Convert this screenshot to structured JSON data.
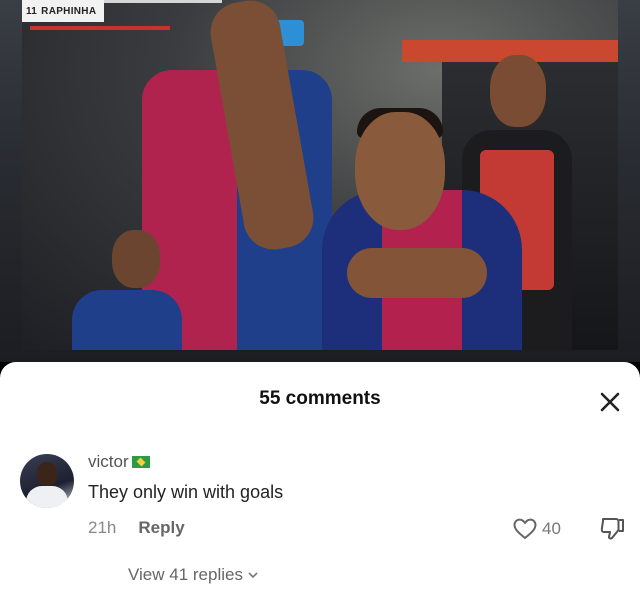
{
  "video": {
    "scorebug_text": "RAPHINHA",
    "scorebug_number": "11"
  },
  "comments_sheet": {
    "title": "55 comments",
    "close_glyph": "✕"
  },
  "comment": {
    "username": "victor",
    "flag_icon": "brazil-flag-icon",
    "text": "They only win with goals",
    "time": "21h",
    "reply_label": "Reply",
    "like_count": "40",
    "view_replies_label": "View 41 replies"
  },
  "colors": {
    "sheet_background": "#ffffff",
    "text_primary": "#222222",
    "text_secondary": "#666666"
  }
}
